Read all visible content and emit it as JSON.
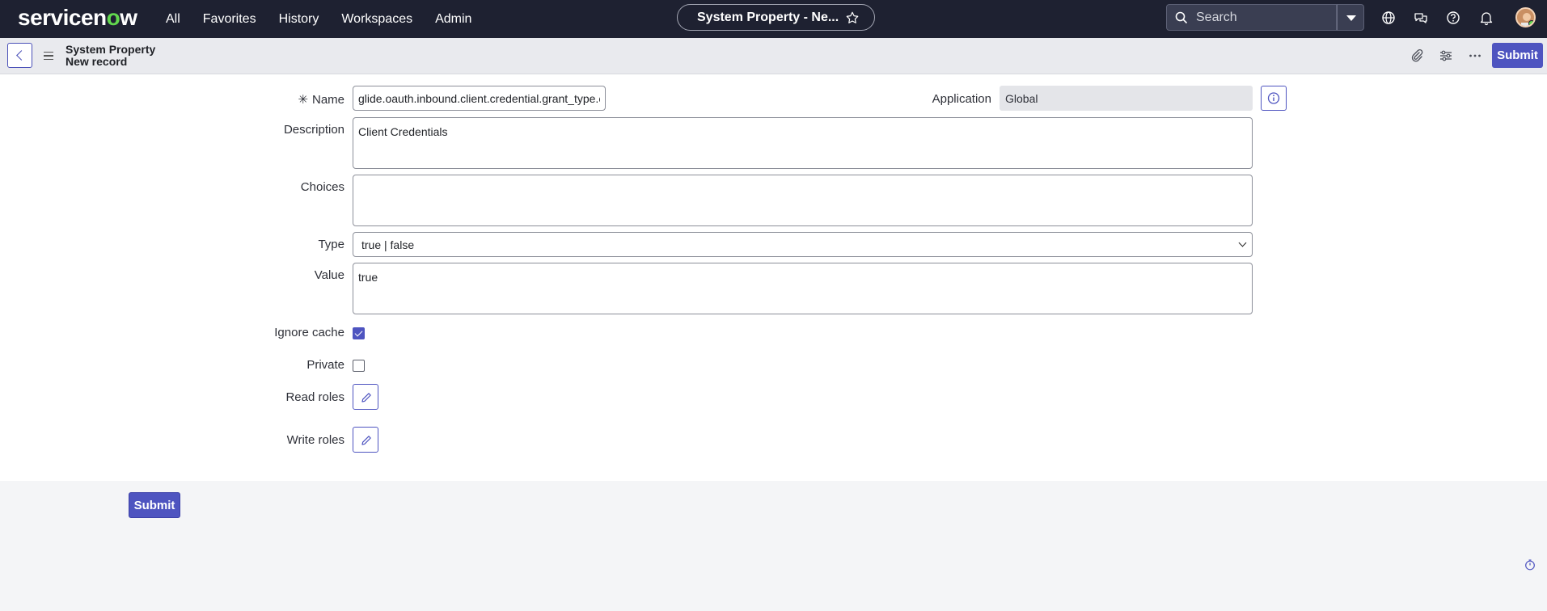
{
  "brand": {
    "logo_service": "servicen",
    "logo_o": "o",
    "logo_w": "w"
  },
  "nav": {
    "links": [
      "All",
      "Favorites",
      "History",
      "Workspaces",
      "Admin"
    ],
    "title_pill": "System Property - Ne...",
    "search_placeholder": "Search"
  },
  "header": {
    "line1": "System Property",
    "line2": "New record",
    "submit_label": "Submit"
  },
  "form": {
    "name_label": "Name",
    "name_required_marker": "✳",
    "name_value": "glide.oauth.inbound.client.credential.grant_type.e",
    "application_label": "Application",
    "application_value": "Global",
    "description_label": "Description",
    "description_value": "Client Credentials",
    "choices_label": "Choices",
    "choices_value": "",
    "type_label": "Type",
    "type_value": "true | false",
    "value_label": "Value",
    "value_value": "true",
    "ignore_cache_label": "Ignore cache",
    "ignore_cache_checked": true,
    "private_label": "Private",
    "private_checked": false,
    "read_roles_label": "Read roles",
    "write_roles_label": "Write roles"
  },
  "footer": {
    "submit_label": "Submit"
  },
  "colors": {
    "primary": "#4e54c0",
    "topbar": "#1e2131",
    "accent_green": "#62d84e"
  }
}
